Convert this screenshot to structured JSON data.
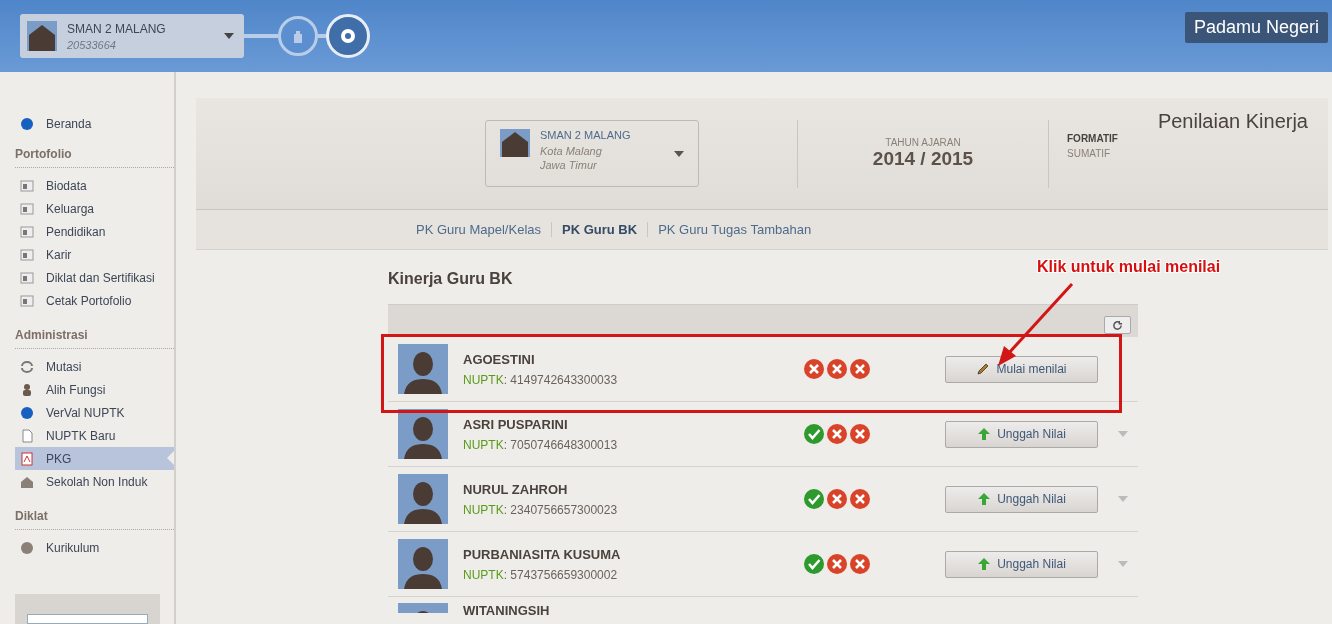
{
  "header": {
    "school": {
      "name": "SMAN 2 MALANG",
      "code": "20533664"
    },
    "brand": "Padamu Negeri"
  },
  "sidebar": {
    "sections": [
      {
        "items": [
          {
            "label": "Beranda",
            "kind": "info",
            "selected": false
          }
        ]
      },
      {
        "title": "Portofolio",
        "items": [
          {
            "label": "Biodata",
            "kind": "card",
            "selected": false
          },
          {
            "label": "Keluarga",
            "kind": "card",
            "selected": false
          },
          {
            "label": "Pendidikan",
            "kind": "card",
            "selected": false
          },
          {
            "label": "Karir",
            "kind": "card",
            "selected": false
          },
          {
            "label": "Diklat dan Sertifikasi",
            "kind": "card",
            "selected": false
          },
          {
            "label": "Cetak Portofolio",
            "kind": "card",
            "selected": false
          }
        ]
      },
      {
        "title": "Administrasi",
        "items": [
          {
            "label": "Mutasi",
            "kind": "sync",
            "selected": false
          },
          {
            "label": "Alih Fungsi",
            "kind": "person",
            "selected": false
          },
          {
            "label": "VerVal NUPTK",
            "kind": "info",
            "selected": false
          },
          {
            "label": "NUPTK Baru",
            "kind": "doc",
            "selected": false
          },
          {
            "label": "PKG",
            "kind": "grade",
            "selected": true
          },
          {
            "label": "Sekolah Non Induk",
            "kind": "house",
            "selected": false
          }
        ]
      },
      {
        "title": "Diklat",
        "items": [
          {
            "label": "Kurikulum",
            "kind": "alert",
            "selected": false
          }
        ]
      }
    ]
  },
  "context": {
    "school": {
      "name": "SMAN 2 MALANG",
      "city": "Kota Malang",
      "province": "Jawa Timur"
    },
    "year_label": "TAHUN AJARAN",
    "year": "2014 / 2015",
    "modes": [
      {
        "label": "FORMATIF",
        "selected": true
      },
      {
        "label": "SUMATIF",
        "selected": false
      }
    ],
    "page_title": "Penilaian Kinerja"
  },
  "tabs": [
    {
      "label": "PK Guru Mapel/Kelas",
      "selected": false
    },
    {
      "label": "PK Guru BK",
      "selected": true
    },
    {
      "label": "PK Guru Tugas Tambahan",
      "selected": false
    }
  ],
  "list": {
    "title": "Kinerja Guru BK",
    "rows": [
      {
        "name": "AGOESTINI",
        "nuptk_label": "NUPTK",
        "separator": ":",
        "nuptk": "4149742643300033",
        "statuses": [
          false,
          false,
          false
        ],
        "action": {
          "kind": "edit",
          "label": "Mulai menilai"
        },
        "caret": false
      },
      {
        "name": "ASRI PUSPARINI",
        "nuptk_label": "NUPTK",
        "separator": ":",
        "nuptk": "7050746648300013",
        "statuses": [
          true,
          false,
          false
        ],
        "action": {
          "kind": "upload",
          "label": "Unggah Nilai"
        },
        "caret": true
      },
      {
        "name": "NURUL ZAHROH",
        "nuptk_label": "NUPTK",
        "separator": ":",
        "nuptk": "2340756657300023",
        "statuses": [
          true,
          false,
          false
        ],
        "action": {
          "kind": "upload",
          "label": "Unggah Nilai"
        },
        "caret": true
      },
      {
        "name": "PURBANIASITA KUSUMA",
        "nuptk_label": "NUPTK",
        "separator": ":",
        "nuptk": "5743756659300002",
        "statuses": [
          true,
          false,
          false
        ],
        "action": {
          "kind": "upload",
          "label": "Unggah Nilai"
        },
        "caret": true
      },
      {
        "name": "WITANINGSIH"
      }
    ]
  },
  "annotation": {
    "text": "Klik untuk mulai menilai"
  }
}
